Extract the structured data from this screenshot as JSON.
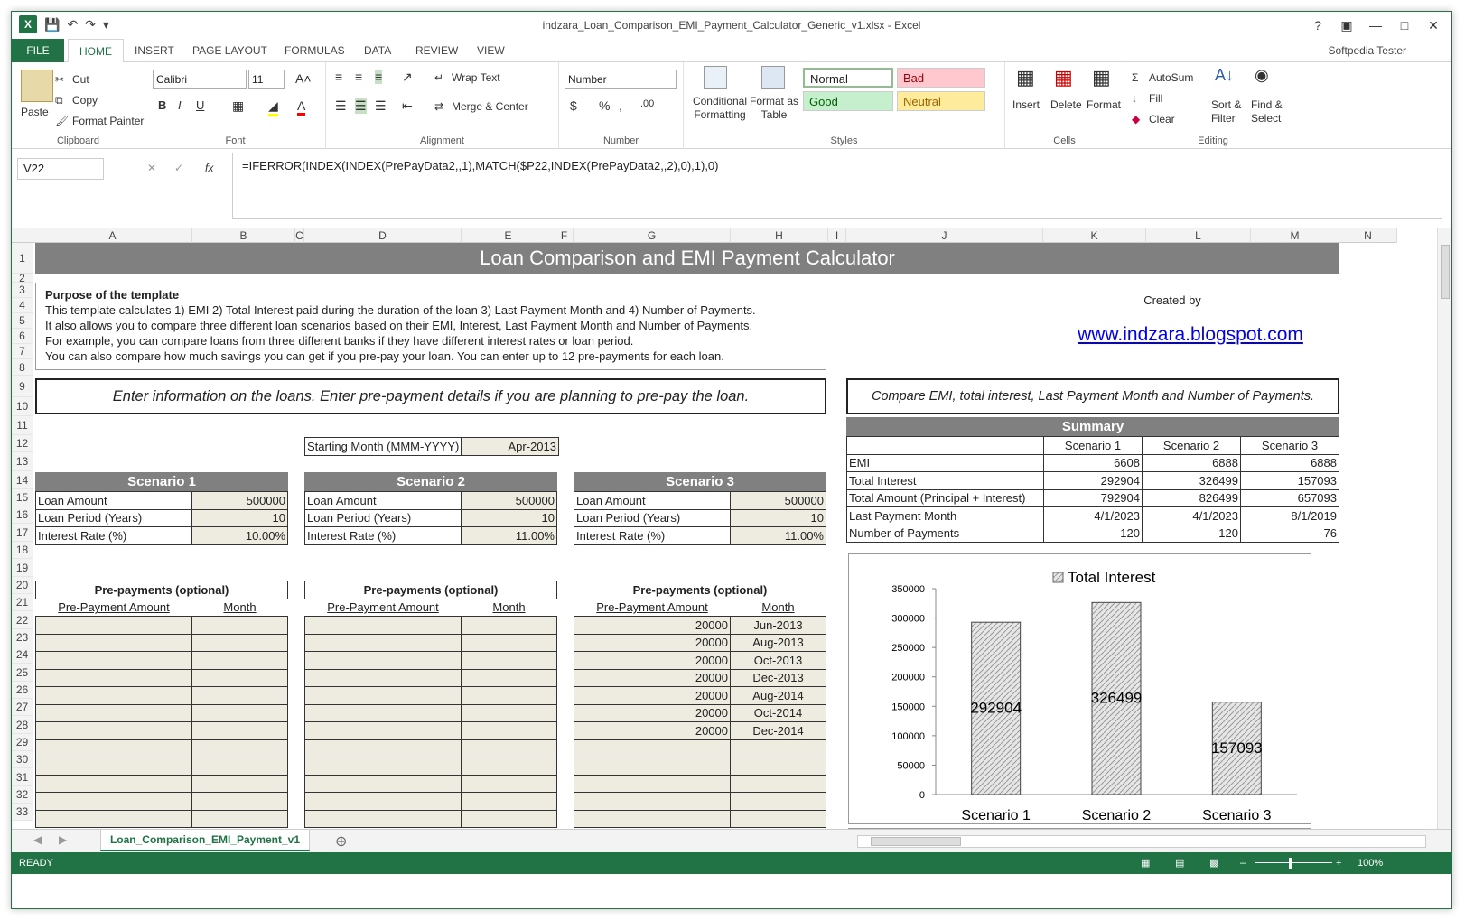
{
  "window": {
    "title": "indzara_Loan_Comparison_EMI_Payment_Calculator_Generic_v1.xlsx - Excel",
    "user": "Softpedia Tester"
  },
  "tabs": [
    "FILE",
    "HOME",
    "INSERT",
    "PAGE LAYOUT",
    "FORMULAS",
    "DATA",
    "REVIEW",
    "VIEW"
  ],
  "ribbon": {
    "clipboard": {
      "paste": "Paste",
      "cut": "Cut",
      "copy": "Copy",
      "format_painter": "Format Painter",
      "label": "Clipboard"
    },
    "font": {
      "name": "Calibri",
      "size": "11",
      "label": "Font",
      "bold": "B",
      "italic": "I",
      "underline": "U"
    },
    "alignment": {
      "wrap": "Wrap Text",
      "merge": "Merge & Center",
      "label": "Alignment"
    },
    "number": {
      "format": "Number",
      "label": "Number",
      "currency": "$",
      "percent": "%"
    },
    "styles": {
      "cond": "Conditional Formatting",
      "fmt_table": "Format as Table",
      "normal": "Normal",
      "bad": "Bad",
      "good": "Good",
      "neutral": "Neutral",
      "label": "Styles"
    },
    "cells": {
      "insert": "Insert",
      "delete": "Delete",
      "format": "Format",
      "label": "Cells"
    },
    "editing": {
      "autosum": "AutoSum",
      "fill": "Fill",
      "clear": "Clear",
      "sort": "Sort & Filter",
      "find": "Find & Select",
      "label": "Editing"
    }
  },
  "formula_bar": {
    "cell": "V22",
    "formula": "=IFERROR(INDEX(INDEX(PrePayData2,,1),MATCH($P22,INDEX(PrePayData2,,2),0),1),0)"
  },
  "columns": [
    "A",
    "B",
    "C",
    "D",
    "E",
    "F",
    "G",
    "H",
    "I",
    "J",
    "K",
    "L",
    "M",
    "N"
  ],
  "sheet": {
    "title": "Loan Comparison and EMI Payment Calculator",
    "purpose_head": "Purpose of the template",
    "purpose_lines": [
      "This template calculates 1) EMI 2) Total Interest paid during the duration of the loan 3) Last Payment Month and 4) Number of Payments.",
      "It also allows you to compare three different loan scenarios based on their EMI, Interest, Last Payment Month and Number of Payments.",
      "For example, you can compare loans from three different banks if they have different interest rates or loan period.",
      "You can also compare how much savings you can get if you pre-pay your loan. You can enter up to 12 pre-payments for each loan."
    ],
    "created_by": "Created by",
    "link": "www.indzara.blogspot.com",
    "enter_info": "Enter information on the loans. Enter pre-payment details if you are planning to pre-pay the loan.",
    "compare_info": "Compare EMI, total interest, Last Payment Month and Number of Payments.",
    "starting_month_label": "Starting Month (MMM-YYYY)",
    "starting_month": "Apr-2013",
    "scenarios": [
      {
        "name": "Scenario 1",
        "amount": "500000",
        "period": "10",
        "rate": "10.00%"
      },
      {
        "name": "Scenario 2",
        "amount": "500000",
        "period": "10",
        "rate": "11.00%"
      },
      {
        "name": "Scenario 3",
        "amount": "500000",
        "period": "10",
        "rate": "11.00%"
      }
    ],
    "labels": {
      "amount": "Loan Amount",
      "period": "Loan Period (Years)",
      "rate": "Interest Rate (%)",
      "prepay": "Pre-payments (optional)",
      "prepay_amt": "Pre-Payment Amount",
      "month": "Month"
    },
    "prepay3": [
      [
        "20000",
        "Jun-2013"
      ],
      [
        "20000",
        "Aug-2013"
      ],
      [
        "20000",
        "Oct-2013"
      ],
      [
        "20000",
        "Dec-2013"
      ],
      [
        "20000",
        "Aug-2014"
      ],
      [
        "20000",
        "Oct-2014"
      ],
      [
        "20000",
        "Dec-2014"
      ]
    ],
    "summary": {
      "title": "Summary",
      "cols": [
        "Scenario 1",
        "Scenario 2",
        "Scenario 3"
      ],
      "rows": [
        [
          "EMI",
          "6608",
          "6888",
          "6888"
        ],
        [
          "Total Interest",
          "292904",
          "326499",
          "157093"
        ],
        [
          "Total Amount (Principal + Interest)",
          "792904",
          "826499",
          "657093"
        ],
        [
          "Last Payment Month",
          "4/1/2023",
          "4/1/2023",
          "8/1/2019"
        ],
        [
          "Number of Payments",
          "120",
          "120",
          "76"
        ]
      ]
    }
  },
  "chart_data": {
    "type": "bar",
    "title": "",
    "legend": [
      "Total Interest"
    ],
    "categories": [
      "Scenario 1",
      "Scenario 2",
      "Scenario 3"
    ],
    "series": [
      {
        "name": "Total Interest",
        "values": [
          292904,
          326499,
          157093
        ]
      }
    ],
    "ylim": [
      0,
      350000
    ],
    "yticks": [
      "350000",
      "300000",
      "250000",
      "200000",
      "150000",
      "100000",
      "50000",
      "0"
    ],
    "data_labels": [
      "292904",
      "326499",
      "157093"
    ]
  },
  "sheet_tab": "Loan_Comparison_EMI_Payment_v1",
  "status": {
    "ready": "READY",
    "zoom": "100%"
  }
}
